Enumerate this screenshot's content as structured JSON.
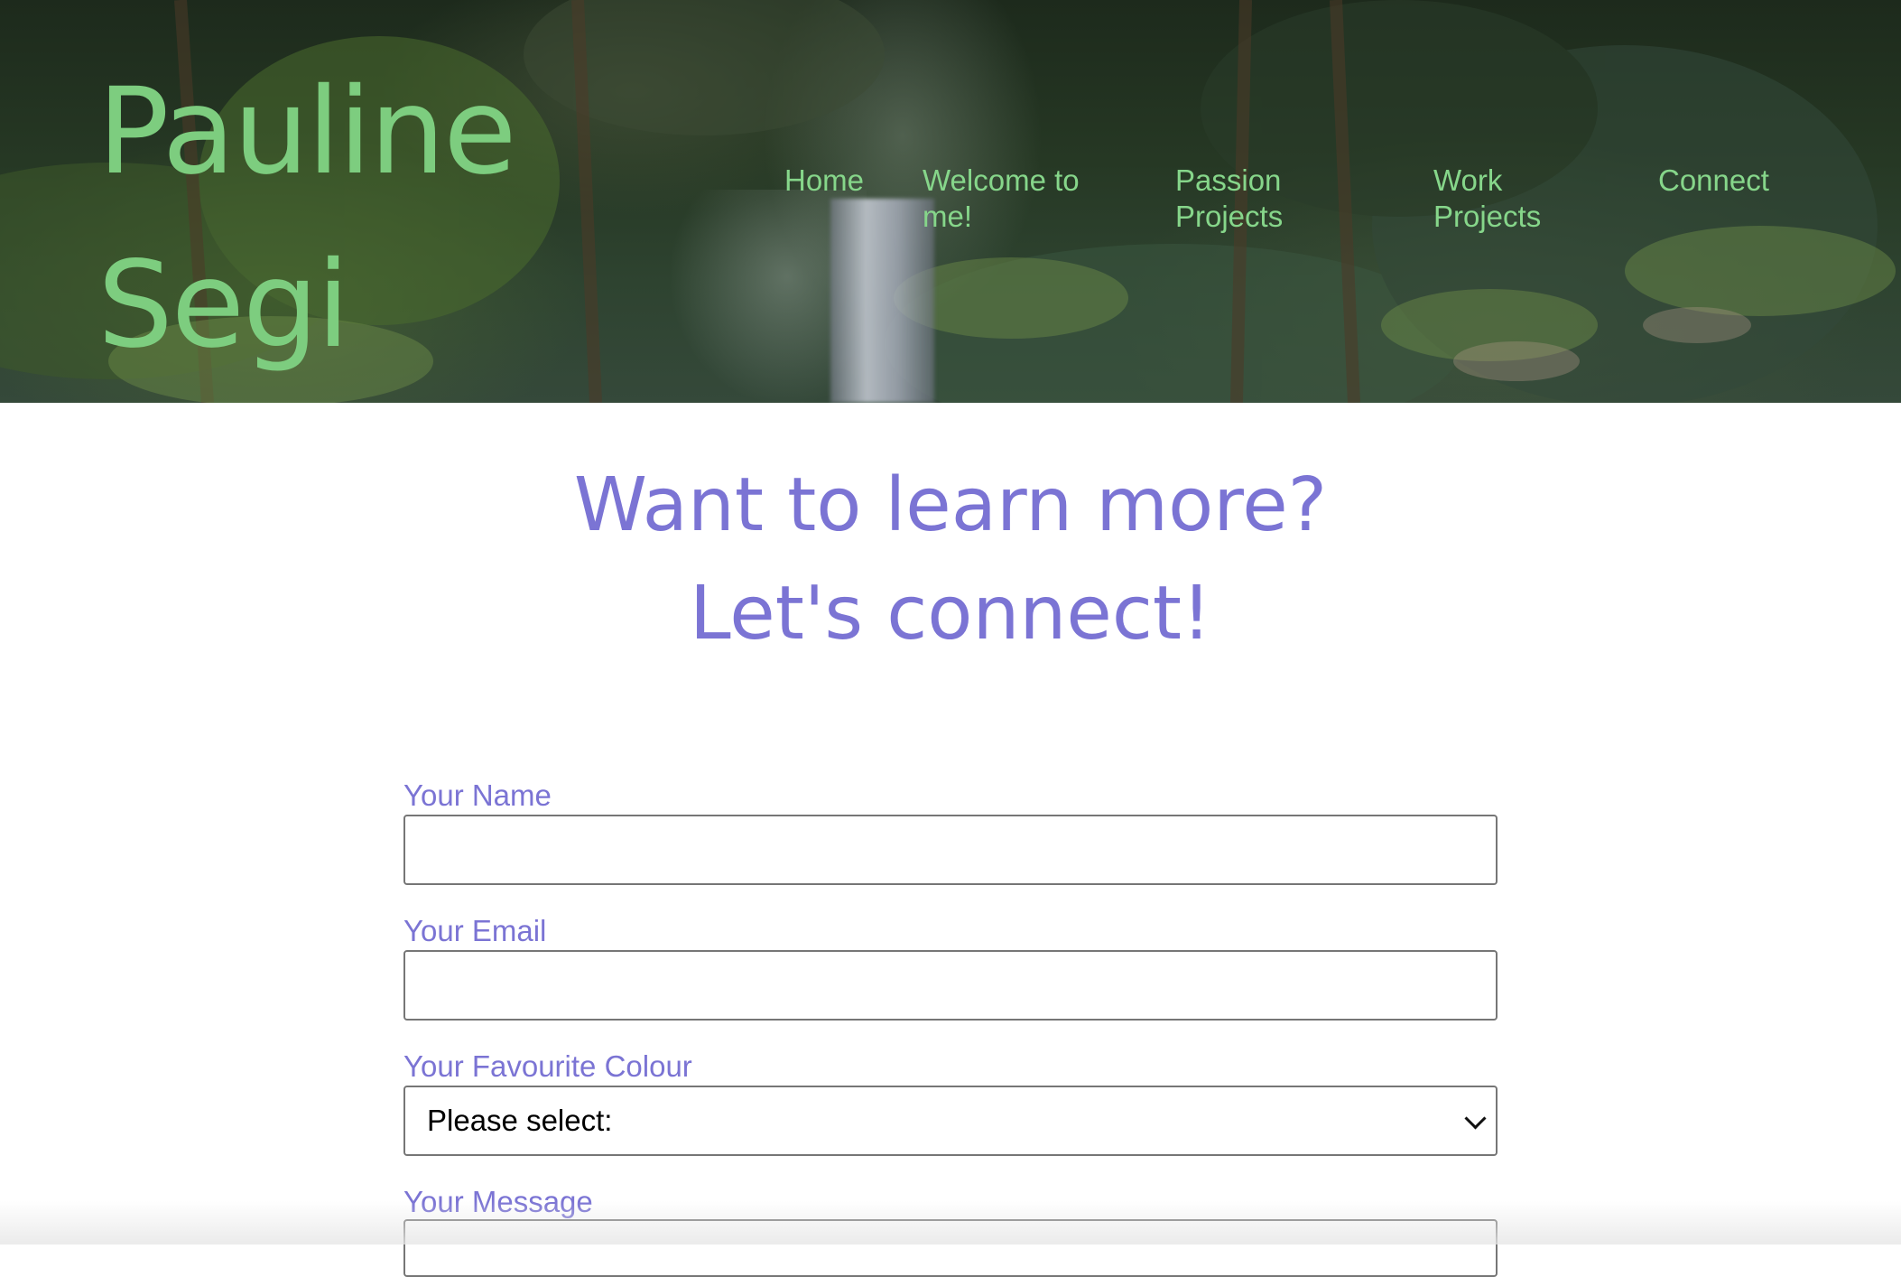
{
  "header": {
    "title_line1": "Pauline",
    "title_line2": "Segi",
    "nav": [
      {
        "label": "Home"
      },
      {
        "label_line1": "Welcome to",
        "label_line2": "me!"
      },
      {
        "label_line1": "Passion",
        "label_line2": "Projects"
      },
      {
        "label_line1": "Work",
        "label_line2": "Projects"
      },
      {
        "label": "Connect"
      }
    ]
  },
  "main": {
    "heading_line1": "Want to learn more?",
    "heading_line2": "Let's connect!"
  },
  "form": {
    "name_label": "Your Name",
    "name_value": "",
    "email_label": "Your Email",
    "email_value": "",
    "colour_label": "Your Favourite Colour",
    "colour_selected": "Please select:",
    "message_label": "Your Message"
  },
  "colors": {
    "title_green": "#7dcd7f",
    "nav_green": "#86d68a",
    "accent_purple": "#7b74d4"
  }
}
